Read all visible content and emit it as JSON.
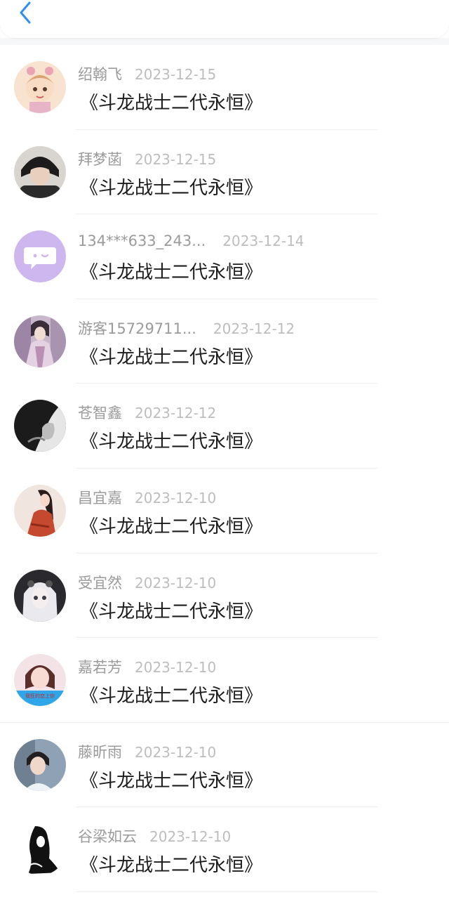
{
  "header": {
    "back_icon": "chevron-left-icon",
    "accent_color": "#2f8ff0"
  },
  "items": [
    {
      "name": "绍翰飞",
      "date": "2023-12-15",
      "title": "《斗龙战士二代永恒》"
    },
    {
      "name": "拜梦菡",
      "date": "2023-12-15",
      "title": "《斗龙战士二代永恒》"
    },
    {
      "name": "134***633_243...",
      "date": "2023-12-14",
      "title": "《斗龙战士二代永恒》"
    },
    {
      "name": "游客15729711...",
      "date": "2023-12-12",
      "title": "《斗龙战士二代永恒》"
    },
    {
      "name": "苍智鑫",
      "date": "2023-12-12",
      "title": "《斗龙战士二代永恒》"
    },
    {
      "name": "昌宜嘉",
      "date": "2023-12-10",
      "title": "《斗龙战士二代永恒》"
    },
    {
      "name": "受宜然",
      "date": "2023-12-10",
      "title": "《斗龙战士二代永恒》"
    },
    {
      "name": "嘉若芳",
      "date": "2023-12-10",
      "title": "《斗龙战士二代永恒》",
      "avatar_caption": "我狂的恋上你"
    },
    {
      "name": "藤昕雨",
      "date": "2023-12-10",
      "title": "《斗龙战士二代永恒》"
    },
    {
      "name": "谷梁如云",
      "date": "2023-12-10",
      "title": "《斗龙战士二代永恒》"
    }
  ]
}
